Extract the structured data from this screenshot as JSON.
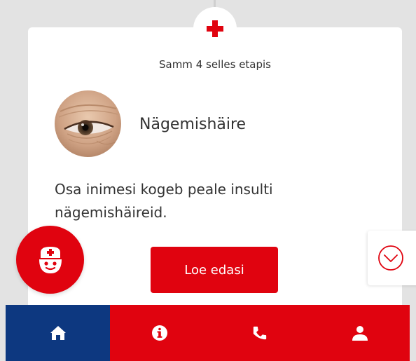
{
  "card": {
    "step_text": "Samm 4 selles etapis",
    "title": "Nägemishäire",
    "body": "Osa inimesi kogeb peale insulti nägemishäireid.",
    "read_more_label": "Loe edasi",
    "badge_icon": "red-cross-icon",
    "avatar_icon": "eye-photo"
  },
  "fab": {
    "icon": "nurse-icon"
  },
  "scroll": {
    "icon": "chevron-down-circle-icon"
  },
  "nav": {
    "items": [
      {
        "icon": "home-icon",
        "active": true
      },
      {
        "icon": "info-icon",
        "active": false
      },
      {
        "icon": "phone-icon",
        "active": false
      },
      {
        "icon": "user-icon",
        "active": false
      }
    ]
  },
  "colors": {
    "brand_red": "#e0030f",
    "nav_active": "#0d3880",
    "background": "#e3e3e3",
    "text": "#333333"
  }
}
